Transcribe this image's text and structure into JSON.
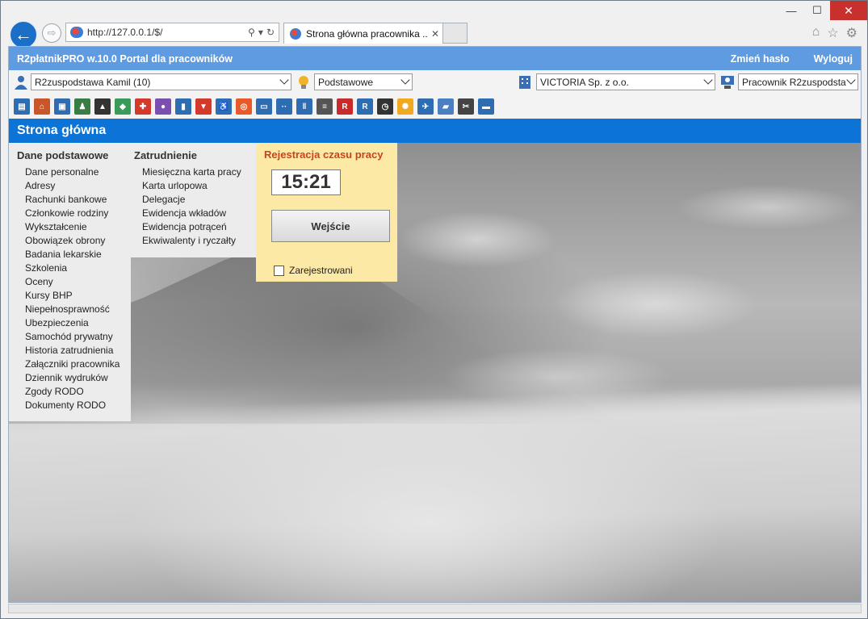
{
  "browser": {
    "url": "http://127.0.0.1/$/",
    "tab_title": "Strona główna pracownika ...",
    "tab_close": "✕"
  },
  "app": {
    "title": "R2płatnikPRO w.10.0 Portal dla pracowników",
    "change_password": "Zmień hasło",
    "logout": "Wyloguj"
  },
  "selectors": {
    "employee": "R2zuspodstawa Kamil (10)",
    "view": "Podstawowe",
    "company": "VICTORIA Sp. z o.o.",
    "role": "Pracownik R2zuspodsta"
  },
  "icons": [
    "id-card-icon",
    "home-icon",
    "profile-card-icon",
    "family-icon",
    "graduation-cap-icon",
    "shield-icon",
    "first-aid-kit-icon",
    "pill-icon",
    "bar-chart-icon",
    "fire-extinguisher-icon",
    "wheelchair-icon",
    "lifebuoy-icon",
    "car-icon",
    "footprints-icon",
    "binders-icon",
    "printer-icon",
    "rodo-stop-icon",
    "rodo-badge-icon",
    "clock-icon",
    "sun-icon",
    "airplane-icon",
    "package-icon",
    "scissors-icon",
    "truck-icon"
  ],
  "page": {
    "header": "Strona główna"
  },
  "menu": {
    "basic_heading": "Dane podstawowe",
    "basic_items": [
      "Dane personalne",
      "Adresy",
      "Rachunki bankowe",
      "Członkowie rodziny",
      "Wykształcenie",
      "Obowiązek obrony",
      "Badania lekarskie",
      "Szkolenia",
      "Oceny",
      "Kursy BHP",
      "Niepełnosprawność",
      "Ubezpieczenia",
      "Samochód prywatny",
      "Historia zatrudnienia",
      "Załączniki pracownika",
      "Dziennik wydruków",
      "Zgody RODO",
      "Dokumenty RODO"
    ],
    "employment_heading": "Zatrudnienie",
    "employment_items": [
      "Miesięczna karta pracy",
      "Karta urlopowa",
      "Delegacje",
      "Ewidencja wkładów",
      "Ewidencja potrąceń",
      "Ekwiwalenty i ryczałty"
    ]
  },
  "time_registration": {
    "heading": "Rejestracja czasu pracy",
    "time": "15:21",
    "entry_button": "Wejście",
    "registered_label": "Zarejestrowani"
  },
  "colors": {
    "topbar": "#5f9be0",
    "page_header": "#0b74d6",
    "registration_panel": "#fde9a6",
    "registration_heading": "#c8441d"
  }
}
